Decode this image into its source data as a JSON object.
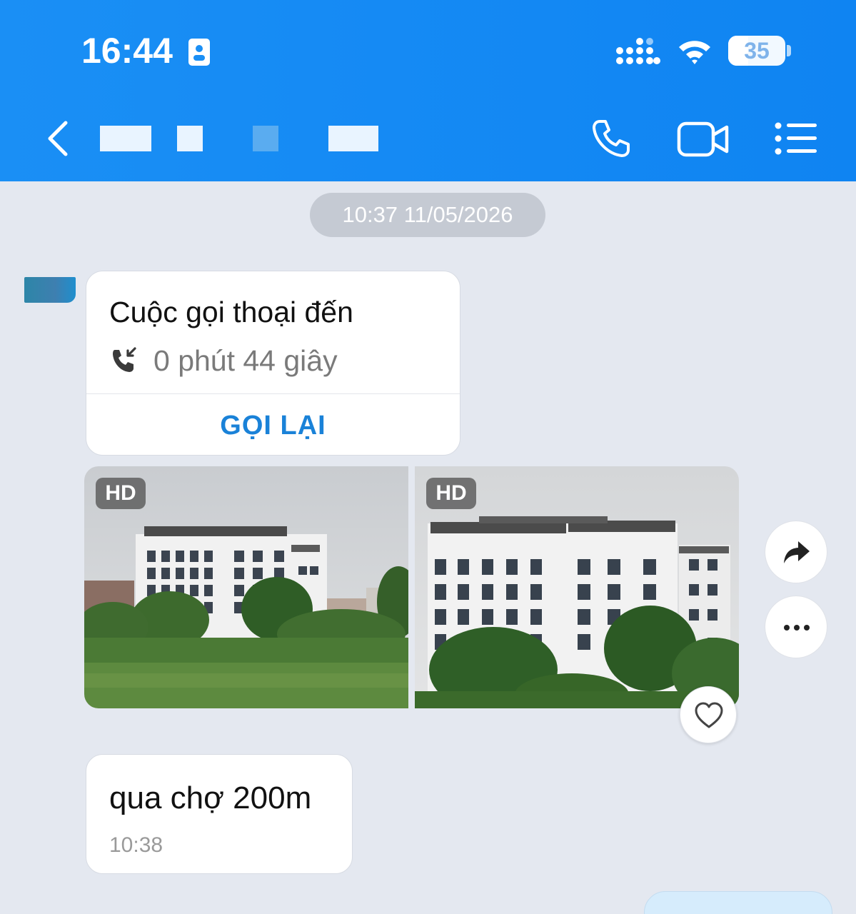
{
  "status_bar": {
    "time": "16:44",
    "battery_level": "35",
    "icons": [
      "id-card-icon",
      "signal-icon",
      "wifi-icon",
      "battery-icon"
    ]
  },
  "header": {
    "icons": [
      "back-icon",
      "phone-call-icon",
      "video-call-icon",
      "menu-list-icon"
    ],
    "accent_color": "#1a8ff5"
  },
  "chat": {
    "date_separator": "10:37 11/05/2026",
    "call_card": {
      "title": "Cuộc gọi thoại đến",
      "duration": "0 phút 44 giây",
      "action_label": "GỌI LẠI",
      "icon": "incoming-call-icon",
      "action_color": "#1a82d8"
    },
    "photos": [
      {
        "badge": "HD"
      },
      {
        "badge": "HD"
      }
    ],
    "photo_actions": [
      "share-arrow-icon",
      "more-dots-icon",
      "heart-icon"
    ],
    "text_message": {
      "text": "qua chợ 200m",
      "time": "10:38"
    }
  }
}
